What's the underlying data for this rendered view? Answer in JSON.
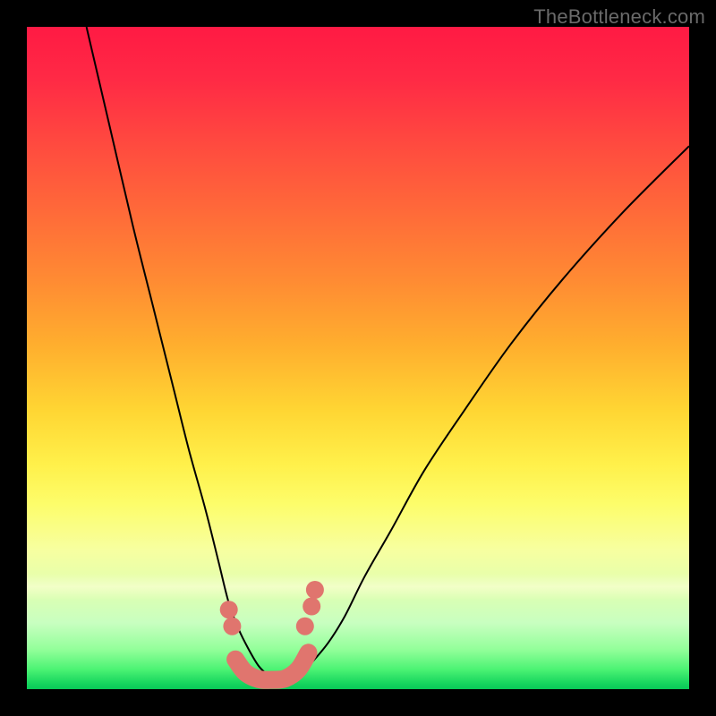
{
  "watermark": "TheBottleneck.com",
  "colors": {
    "gradient_top": "#ff1a44",
    "gradient_mid": "#ffd633",
    "gradient_bottom": "#08c858",
    "bead": "#e0756e",
    "curve": "#000000",
    "frame": "#000000"
  },
  "chart_data": {
    "type": "line",
    "title": "",
    "xlabel": "",
    "ylabel": "",
    "xlim": [
      0,
      100
    ],
    "ylim": [
      0,
      100
    ],
    "series": [
      {
        "name": "left-curve",
        "x": [
          9,
          12.5,
          16,
          19,
          22,
          24.5,
          27,
          29,
          30.5,
          32,
          33.5,
          35,
          36.5
        ],
        "y": [
          100,
          85,
          70,
          58,
          46,
          36,
          27,
          19,
          13,
          9,
          6,
          3.5,
          2
        ]
      },
      {
        "name": "right-curve",
        "x": [
          41,
          43,
          45.5,
          48,
          51,
          55,
          60,
          66,
          73,
          81,
          90,
          100
        ],
        "y": [
          2,
          4,
          7,
          11,
          17,
          24,
          33,
          42,
          52,
          62,
          72,
          82
        ]
      },
      {
        "name": "garland",
        "x": [
          31.5,
          33,
          35,
          37,
          39,
          41,
          42.5
        ],
        "y": [
          4.5,
          2.5,
          1.5,
          1.4,
          1.6,
          3,
          5.5
        ]
      }
    ],
    "beads": [
      {
        "x": 30.5,
        "y": 12.0
      },
      {
        "x": 31.0,
        "y": 9.5
      },
      {
        "x": 42.0,
        "y": 9.5
      },
      {
        "x": 43.0,
        "y": 12.5
      },
      {
        "x": 43.5,
        "y": 15.0
      }
    ],
    "annotations": []
  }
}
